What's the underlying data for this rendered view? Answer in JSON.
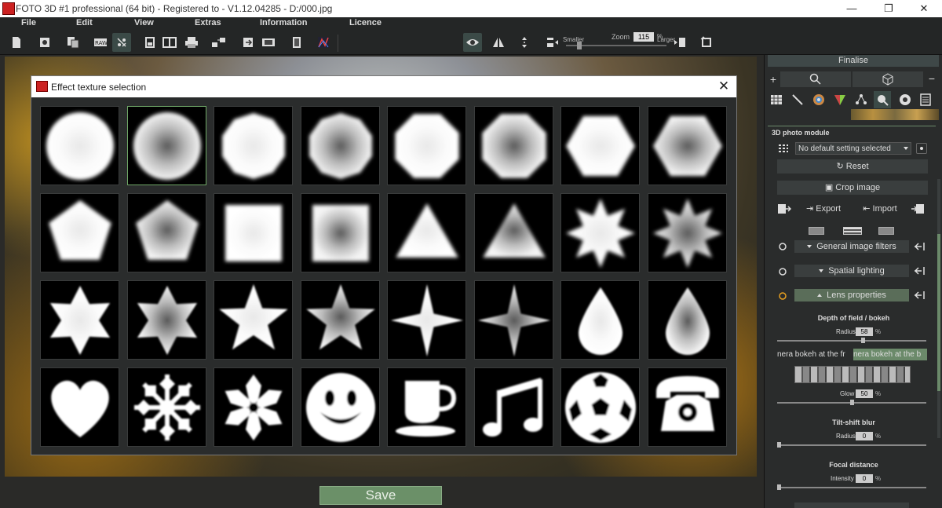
{
  "window": {
    "title": "FOTO 3D #1 professional (64 bit) - Registered to - V1.12.04285 - D:/000.jpg",
    "minimize": "—",
    "maximize": "❐",
    "close": "✕"
  },
  "menu": {
    "file": "File",
    "edit": "Edit",
    "view": "View",
    "extras": "Extras",
    "information": "Information",
    "licence": "Licence"
  },
  "toolbar": {
    "zoom_label": "Zoom",
    "zoom_value": "115",
    "zoom_unit": "%",
    "smaller": "Smaller",
    "larger": "Larger"
  },
  "dialog": {
    "title": "Effect texture selection",
    "close": "✕",
    "selected_index": 1,
    "textures": [
      "soft-circle-light",
      "soft-circle-dark",
      "soft-decagon-light",
      "soft-decagon-dark",
      "soft-octagon-light",
      "soft-octagon-dark",
      "soft-hexagon-light",
      "soft-hexagon-dark",
      "soft-pentagon-light",
      "soft-pentagon-dark",
      "soft-square-light",
      "soft-square-dark",
      "soft-triangle-light",
      "soft-triangle-dark",
      "soft-8star-light",
      "soft-8star-dark",
      "6star-light",
      "6star-dark",
      "5star-light",
      "5star-dark",
      "4star-light",
      "4star-dark",
      "drop-light",
      "drop-dark",
      "heart",
      "snowflake-a",
      "snowflake-b",
      "smiley",
      "coffee-cup",
      "music-note",
      "football",
      "telephone"
    ]
  },
  "save_label": "Save",
  "panel": {
    "finalise": "Finalise",
    "plus": "+",
    "minus": "−",
    "module_title": "3D photo module",
    "preset": "No default setting selected",
    "reset": "Reset",
    "crop": "Crop image",
    "export": "Export",
    "import": "Import",
    "general_filters": "General image filters",
    "spatial_lighting": "Spatial lighting",
    "lens_properties": "Lens properties",
    "dof_title": "Depth of field / bokeh",
    "radius_label": "Radius",
    "radius_value": "58",
    "pct": "%",
    "bokeh_front": "nera bokeh at the fr",
    "bokeh_back": "nera bokeh at the b",
    "glow_label": "Glow",
    "glow_value": "50",
    "tilt_title": "Tilt-shift blur",
    "tilt_radius_label": "Radius",
    "tilt_radius_value": "0",
    "focal_title": "Focal distance",
    "intensity_label": "Intensity",
    "intensity_value": "0",
    "values": {
      "radius": 58,
      "glow": 50,
      "tilt_radius": 0,
      "intensity": 0
    }
  },
  "colors": {
    "accent_green": "#6b9068",
    "panel_bg": "#2a2c2c",
    "selection": "#6fa867"
  }
}
